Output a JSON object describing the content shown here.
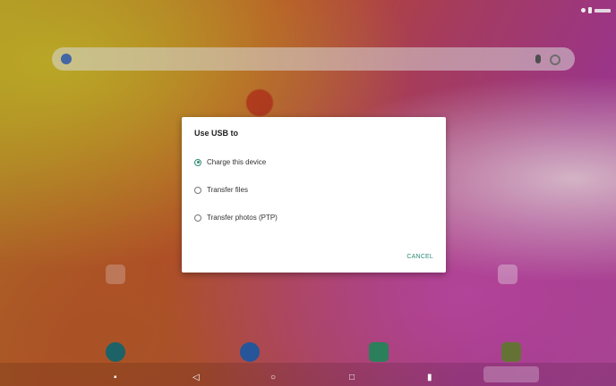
{
  "dialog": {
    "title": "Use USB to",
    "options": [
      {
        "label": "Charge this device",
        "selected": true
      },
      {
        "label": "Transfer files",
        "selected": false
      },
      {
        "label": "Transfer photos (PTP)",
        "selected": false
      }
    ],
    "cancel_label": "CANCEL"
  },
  "colors": {
    "accent": "#2e8b74",
    "dialog_bg": "#ffffff"
  },
  "icons": {
    "status": [
      "wifi-icon",
      "battery-icon"
    ],
    "search": [
      "google-icon",
      "mic-icon",
      "lens-icon"
    ],
    "nav": [
      "home-dot-icon",
      "back-icon",
      "home-icon",
      "recents-icon",
      "screenshot-icon",
      "apps-icon"
    ]
  }
}
